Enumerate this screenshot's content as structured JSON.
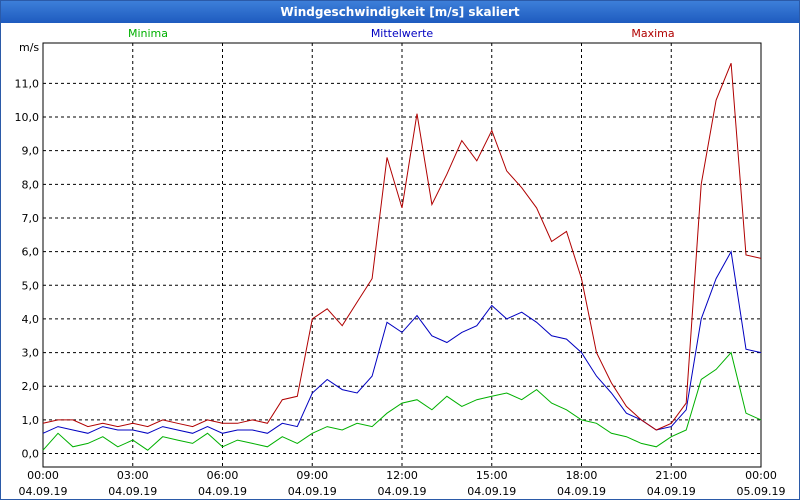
{
  "window": {
    "title": "Windgeschwindigkeit [m/s] skaliert"
  },
  "chart_data": {
    "type": "line",
    "title": "Windgeschwindigkeit [m/s] skaliert",
    "ylabel": "m/s",
    "xlabel": "",
    "ylim": [
      -0.4,
      12.2
    ],
    "xlim_hours": [
      0,
      24
    ],
    "yticks": [
      "0,0",
      "1,0",
      "2,0",
      "3,0",
      "4,0",
      "5,0",
      "6,0",
      "7,0",
      "8,0",
      "9,0",
      "10,0",
      "11,0"
    ],
    "ytick_values": [
      0,
      1,
      2,
      3,
      4,
      5,
      6,
      7,
      8,
      9,
      10,
      11
    ],
    "xtick_values_hours": [
      0,
      3,
      6,
      9,
      12,
      15,
      18,
      21,
      24
    ],
    "xticks": [
      {
        "time": "00:00",
        "date": "04.09.19"
      },
      {
        "time": "03:00",
        "date": "04.09.19"
      },
      {
        "time": "06:00",
        "date": "04.09.19"
      },
      {
        "time": "09:00",
        "date": "04.09.19"
      },
      {
        "time": "12:00",
        "date": "04.09.19"
      },
      {
        "time": "15:00",
        "date": "04.09.19"
      },
      {
        "time": "18:00",
        "date": "04.09.19"
      },
      {
        "time": "21:00",
        "date": "04.09.19"
      },
      {
        "time": "00:00",
        "date": "05.09.19"
      }
    ],
    "grid": true,
    "legend_placement": "top",
    "series": [
      {
        "name": "Minima",
        "color": "#00b000",
        "x": [
          0,
          0.5,
          1,
          1.5,
          2,
          2.5,
          3,
          3.5,
          4,
          4.5,
          5,
          5.5,
          6,
          6.5,
          7,
          7.5,
          8,
          8.5,
          9,
          9.5,
          10,
          10.5,
          11,
          11.5,
          12,
          12.5,
          13,
          13.5,
          14,
          14.5,
          15,
          15.5,
          16,
          16.5,
          17,
          17.5,
          18,
          18.5,
          19,
          19.5,
          20,
          20.5,
          21,
          21.5,
          22,
          22.5,
          23,
          23.5,
          24
        ],
        "values": [
          0.1,
          0.6,
          0.2,
          0.3,
          0.5,
          0.2,
          0.4,
          0.1,
          0.5,
          0.4,
          0.3,
          0.6,
          0.2,
          0.4,
          0.3,
          0.2,
          0.5,
          0.3,
          0.6,
          0.8,
          0.7,
          0.9,
          0.8,
          1.2,
          1.5,
          1.6,
          1.3,
          1.7,
          1.4,
          1.6,
          1.7,
          1.8,
          1.6,
          1.9,
          1.5,
          1.3,
          1.0,
          0.9,
          0.6,
          0.5,
          0.3,
          0.2,
          0.5,
          0.7,
          2.2,
          2.5,
          3.0,
          1.2,
          1.0
        ]
      },
      {
        "name": "Mittelwerte",
        "color": "#0000c0",
        "x": [
          0,
          0.5,
          1,
          1.5,
          2,
          2.5,
          3,
          3.5,
          4,
          4.5,
          5,
          5.5,
          6,
          6.5,
          7,
          7.5,
          8,
          8.5,
          9,
          9.5,
          10,
          10.5,
          11,
          11.5,
          12,
          12.5,
          13,
          13.5,
          14,
          14.5,
          15,
          15.5,
          16,
          16.5,
          17,
          17.5,
          18,
          18.5,
          19,
          19.5,
          20,
          20.5,
          21,
          21.5,
          22,
          22.5,
          23,
          23.5,
          24
        ],
        "values": [
          0.6,
          0.8,
          0.7,
          0.6,
          0.8,
          0.7,
          0.7,
          0.6,
          0.8,
          0.7,
          0.6,
          0.8,
          0.6,
          0.7,
          0.7,
          0.6,
          0.9,
          0.8,
          1.8,
          2.2,
          1.9,
          1.8,
          2.3,
          3.9,
          3.6,
          4.1,
          3.5,
          3.3,
          3.6,
          3.8,
          4.4,
          4.0,
          4.2,
          3.9,
          3.5,
          3.4,
          3.0,
          2.3,
          1.8,
          1.2,
          1.0,
          0.7,
          0.8,
          1.3,
          4.0,
          5.2,
          6.0,
          3.1,
          3.0
        ]
      },
      {
        "name": "Maxima",
        "color": "#b00000",
        "x": [
          0,
          0.5,
          1,
          1.5,
          2,
          2.5,
          3,
          3.5,
          4,
          4.5,
          5,
          5.5,
          6,
          6.5,
          7,
          7.5,
          8,
          8.5,
          9,
          9.5,
          10,
          10.5,
          11,
          11.5,
          12,
          12.5,
          13,
          13.5,
          14,
          14.5,
          15,
          15.5,
          16,
          16.5,
          17,
          17.5,
          18,
          18.5,
          19,
          19.5,
          20,
          20.5,
          21,
          21.5,
          22,
          22.5,
          23,
          23.5,
          24
        ],
        "values": [
          0.9,
          1.0,
          1.0,
          0.8,
          0.9,
          0.8,
          0.9,
          0.8,
          1.0,
          0.9,
          0.8,
          1.0,
          0.9,
          0.9,
          1.0,
          0.9,
          1.6,
          1.7,
          4.0,
          4.3,
          3.8,
          4.5,
          5.2,
          8.8,
          7.3,
          10.1,
          7.4,
          8.3,
          9.3,
          8.7,
          9.6,
          8.4,
          7.9,
          7.3,
          6.3,
          6.6,
          5.2,
          3.0,
          2.1,
          1.4,
          1.0,
          0.7,
          0.9,
          1.5,
          8.0,
          10.5,
          11.6,
          5.9,
          5.8
        ]
      }
    ]
  }
}
